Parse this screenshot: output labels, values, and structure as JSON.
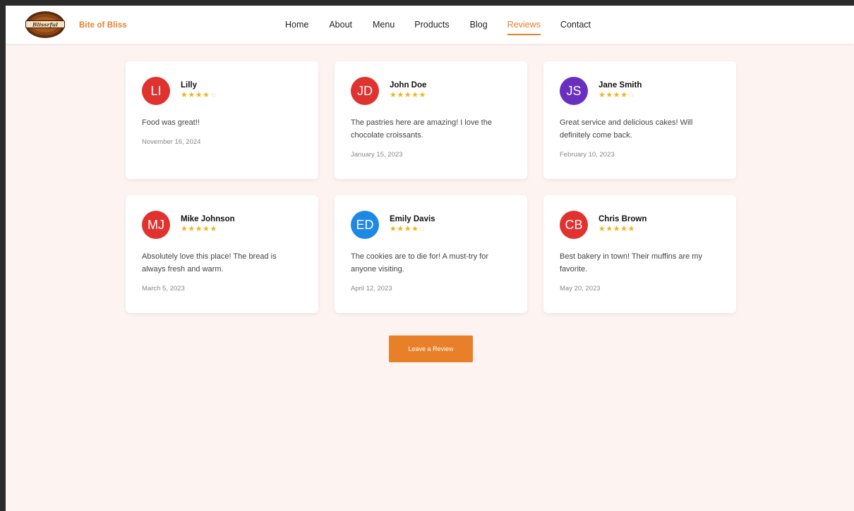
{
  "brand": {
    "name": "Bite of Bliss",
    "logo_text": "Blissrful"
  },
  "nav": [
    {
      "label": "Home",
      "active": false
    },
    {
      "label": "About",
      "active": false
    },
    {
      "label": "Menu",
      "active": false
    },
    {
      "label": "Products",
      "active": false
    },
    {
      "label": "Blog",
      "active": false
    },
    {
      "label": "Reviews",
      "active": true
    },
    {
      "label": "Contact",
      "active": false
    }
  ],
  "reviews": [
    {
      "initials": "LI",
      "name": "Lilly",
      "rating": 4,
      "color": "#e0322e",
      "text": "Food was great!!",
      "date": "November 16, 2024"
    },
    {
      "initials": "JD",
      "name": "John Doe",
      "rating": 5,
      "color": "#e0322e",
      "text": "The pastries here are amazing! I love the chocolate croissants.",
      "date": "January 15, 2023"
    },
    {
      "initials": "JS",
      "name": "Jane Smith",
      "rating": 4,
      "color": "#6a2fbf",
      "text": "Great service and delicious cakes! Will definitely come back.",
      "date": "February 10, 2023"
    },
    {
      "initials": "MJ",
      "name": "Mike Johnson",
      "rating": 5,
      "color": "#e0322e",
      "text": "Absolutely love this place! The bread is always fresh and warm.",
      "date": "March 5, 2023"
    },
    {
      "initials": "ED",
      "name": "Emily Davis",
      "rating": 4,
      "color": "#1e88e5",
      "text": "The cookies are to die for! A must-try for anyone visiting.",
      "date": "April 12, 2023"
    },
    {
      "initials": "CB",
      "name": "Chris Brown",
      "rating": 5,
      "color": "#e0322e",
      "text": "Best bakery in town! Their muffins are my favorite.",
      "date": "May 20, 2023"
    }
  ],
  "cta": {
    "label": "Leave a Review"
  },
  "colors": {
    "accent": "#e8802a",
    "background": "#fdf3f0",
    "star": "#f3b21b"
  }
}
